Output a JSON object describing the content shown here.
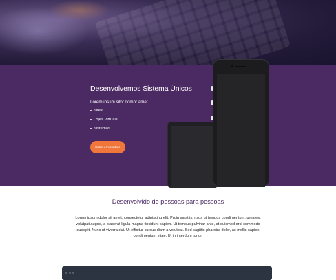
{
  "hero": {
    "title": "Desenvolvemos Sistema Únicos",
    "subtitle": "Lorem ipsum silor domor amet",
    "items": [
      "Sites",
      "Lojes Virtuais",
      "Sistemas"
    ],
    "cta_label": "Entre em contato",
    "cta_color": "#f0763c",
    "background_color": "#4b2a63"
  },
  "section2": {
    "title": "Desenvolvido de pessoas para pessoas",
    "body": "Lorem ipsum dolor sit amet, consectetur adipiscing elit. Proin sagittis, risus ut tempus condimentum, urna est volutpat augue, a placerat ligula magna tincidunt sapien. Ut tempus pulvinar ante, at euismod orci commodo suscipit. Nunc ut viverra dui. Ut efficitur cursus diam a volutpat. Sed sagittis pharetra dolor, ac mollis sapien condimentum vitae. Ut in interdum tortor."
  },
  "icons": {
    "code_window_dots": [
      "window-dot-icon",
      "window-dot-icon",
      "window-dot-icon"
    ]
  }
}
